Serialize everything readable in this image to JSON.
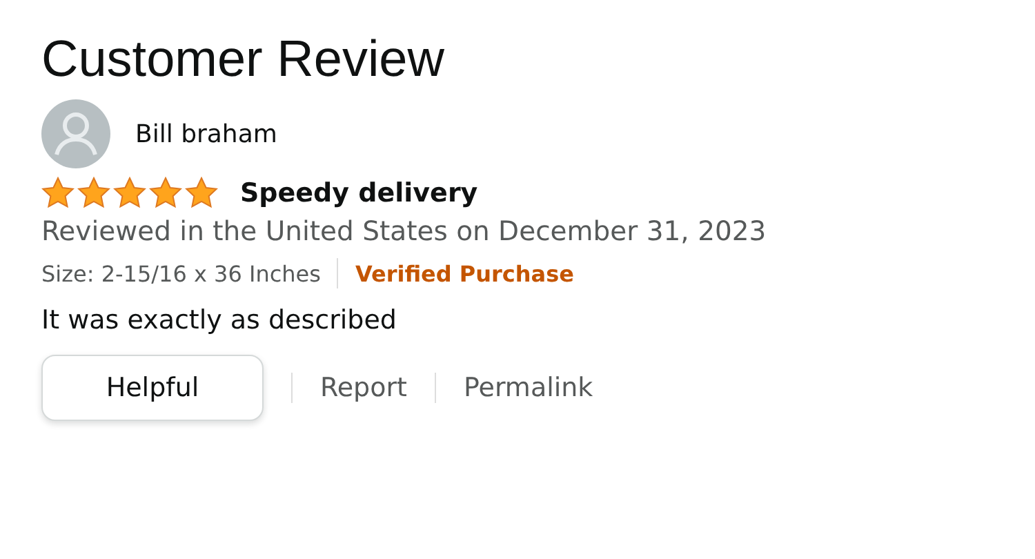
{
  "heading": "Customer Review",
  "reviewer": {
    "name": "Bill braham"
  },
  "review": {
    "stars": 5,
    "title": "Speedy delivery",
    "meta": "Reviewed in the United States on December 31, 2023",
    "size": "Size: 2-15/16 x 36 Inches",
    "verified": "Verified Purchase",
    "body": "It was exactly as described"
  },
  "actions": [
    {
      "label": "Helpful",
      "kind": "button"
    },
    {
      "label": "Report",
      "kind": "link"
    },
    {
      "label": "Permalink",
      "kind": "link"
    }
  ]
}
